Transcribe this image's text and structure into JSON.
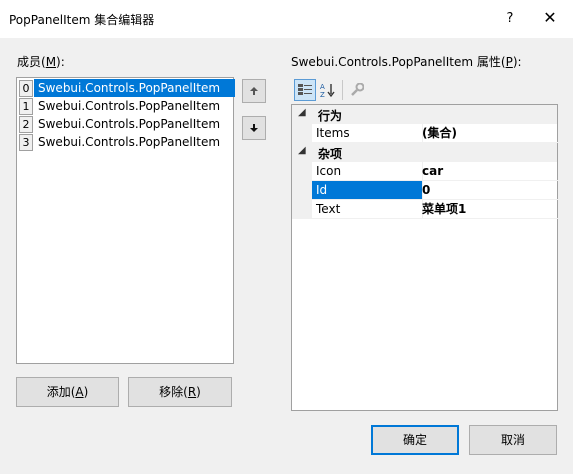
{
  "window": {
    "title": "PopPanelItem 集合编辑器",
    "help": "?",
    "close": "✕"
  },
  "members": {
    "label": "成员(",
    "label_key": "M",
    "label_end": "):",
    "items": [
      {
        "index": "0",
        "text": "Swebui.Controls.PopPanelItem"
      },
      {
        "index": "1",
        "text": "Swebui.Controls.PopPanelItem"
      },
      {
        "index": "2",
        "text": "Swebui.Controls.PopPanelItem"
      },
      {
        "index": "3",
        "text": "Swebui.Controls.PopPanelItem"
      }
    ],
    "add_label": "添加(",
    "add_key": "A",
    "add_end": ")",
    "remove_label": "移除(",
    "remove_key": "R",
    "remove_end": ")"
  },
  "properties": {
    "label": "Swebui.Controls.PopPanelItem 属性(",
    "label_key": "P",
    "label_end": "):",
    "categories": [
      {
        "name": "行为",
        "rows": [
          {
            "name": "Items",
            "value": "(集合)"
          }
        ]
      },
      {
        "name": "杂项",
        "rows": [
          {
            "name": "Icon",
            "value": "car"
          },
          {
            "name": "Id",
            "value": "0"
          },
          {
            "name": "Text",
            "value": "菜单项1"
          }
        ]
      }
    ]
  },
  "footer": {
    "ok": "确定",
    "cancel": "取消"
  },
  "colors": {
    "accent": "#0078d7"
  },
  "icons": [
    "categorized-icon",
    "alphabetical-icon",
    "property-pages-icon",
    "move-up-icon",
    "move-down-icon"
  ]
}
